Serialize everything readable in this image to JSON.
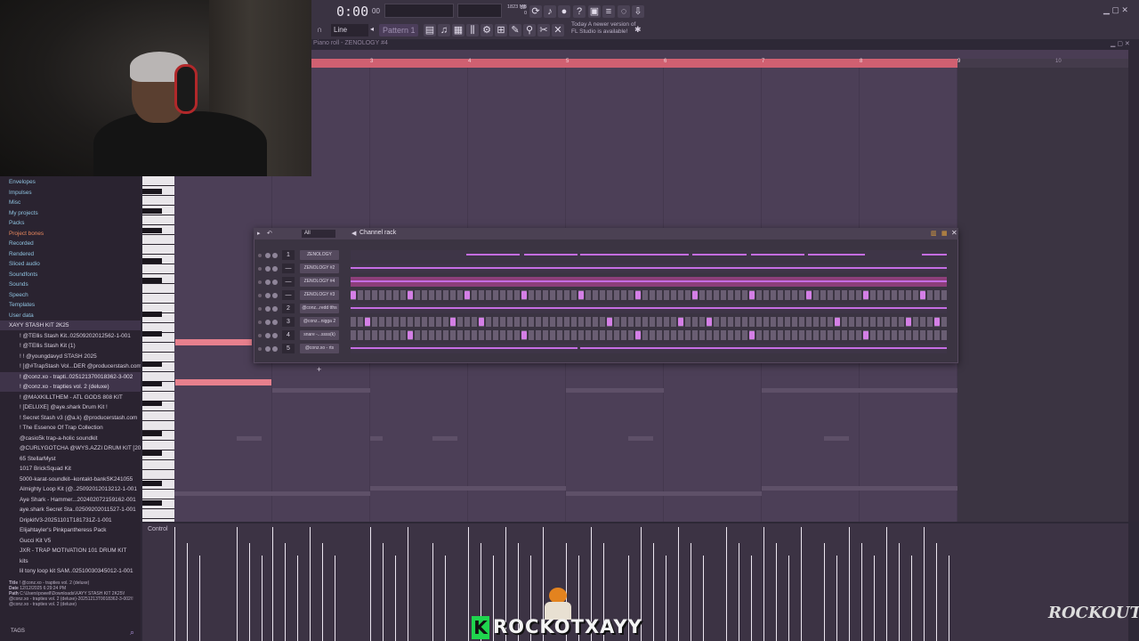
{
  "toolbar": {
    "time": "0:00",
    "time_sub": "00",
    "pattern": "Pattern 1",
    "snap": "Line",
    "cpu": "18",
    "mem": "1823 MB",
    "mem_sub": "0",
    "news_line1": "Today  A newer version of",
    "news_line2": "FL Studio is available!"
  },
  "piano_roll": {
    "title": "Piano roll - ZENOLOGY #4",
    "timeline_numbers": [
      "3",
      "4",
      "5",
      "6",
      "7",
      "8",
      "9",
      "10"
    ],
    "control_label": "Control"
  },
  "browser": {
    "items": [
      {
        "label": "Envelopes",
        "kind": "top"
      },
      {
        "label": "Impulses",
        "kind": "top"
      },
      {
        "label": "Misc",
        "kind": "top"
      },
      {
        "label": "My projects",
        "kind": "top"
      },
      {
        "label": "Packs",
        "kind": "top"
      },
      {
        "label": "Project bones",
        "kind": "proj"
      },
      {
        "label": "Recorded",
        "kind": "top"
      },
      {
        "label": "Rendered",
        "kind": "top"
      },
      {
        "label": "Sliced audio",
        "kind": "top"
      },
      {
        "label": "Soundfonts",
        "kind": "top"
      },
      {
        "label": "Sounds",
        "kind": "top"
      },
      {
        "label": "Speech",
        "kind": "top"
      },
      {
        "label": "Templates",
        "kind": "top"
      },
      {
        "label": "User data",
        "kind": "top"
      },
      {
        "label": "XAYY STASH KIT 2K25",
        "kind": "sel"
      },
      {
        "label": "! @TEllis Stash Kit..02509202012562-1-001",
        "kind": "sub"
      },
      {
        "label": "! @TEllis Stash Kit (1)",
        "kind": "sub"
      },
      {
        "label": "! ! @youngdavyd STASH 2025",
        "kind": "sub"
      },
      {
        "label": "! [@#TrapStash Vol...DER @producerstash.com",
        "kind": "sub"
      },
      {
        "label": "! @conz.xo - trapti..025121370018362-3-002",
        "kind": "sel"
      },
      {
        "label": "! @conz.xo - trapties vol. 2 (deluxe)",
        "kind": "sel"
      },
      {
        "label": "! @MAXKILLTHEM - ATL GODS 808 KIT",
        "kind": "sub"
      },
      {
        "label": "! [DELUXE] @aye.shark Drum Kit !",
        "kind": "sub"
      },
      {
        "label": "! Secret Stash v3 (@a.k) @producerstash.com",
        "kind": "sub"
      },
      {
        "label": "! The Essence Of Trap Collection",
        "kind": "sub"
      },
      {
        "label": "@casio5k trap-a-holic soundkit",
        "kind": "sub"
      },
      {
        "label": "@CURLYGOTCHA @WYS.AZZI DRUM KIT [200+]",
        "kind": "sub"
      },
      {
        "label": "65 StellarMyst",
        "kind": "sub"
      },
      {
        "label": "1017 BrickSquad Kit",
        "kind": "sub"
      },
      {
        "label": "5000-karat-soundkit--kontakt-bankSK241055",
        "kind": "sub"
      },
      {
        "label": "Almighty Loop Kit (@..25092012013212-1-001",
        "kind": "sub"
      },
      {
        "label": "Aye Shark - Hammer...202402072159162-001",
        "kind": "sub"
      },
      {
        "label": "aye.shark Secret Sta..02509202011527-1-001",
        "kind": "sub"
      },
      {
        "label": "DripkitV3-20251101T181731Z-1-001",
        "kind": "sub"
      },
      {
        "label": "Elijahtayler's Pinkpantheress Pack",
        "kind": "sub"
      },
      {
        "label": "Gucci Kit V5",
        "kind": "sub"
      },
      {
        "label": "JXR - TRAP MOTIVATION 101 DRUM KIT",
        "kind": "sub"
      },
      {
        "label": "kits",
        "kind": "sub"
      },
      {
        "label": "lil tony loop kit SAM..02510030345012-1-001",
        "kind": "sub"
      }
    ],
    "info_title_label": "Title",
    "info_title": "! @conz.xo - trapties vol. 2 (deluxe)",
    "info_date_label": "Date",
    "info_date": "12/12/2025 6:29:24 PM",
    "info_path_label": "Path",
    "info_path": "C:\\Users\\powell\\Downloads\\XAYY STASH KIT 2K25\\! @conz.xo - trapties vol. 2 (deluxe)-20251213T0018362-3-002\\! @conz.xo - trapties vol. 2 (deluxe)",
    "tags_label": "TAGS"
  },
  "channel_rack": {
    "title": "Channel rack",
    "filter": "All",
    "channels": [
      {
        "num": "1",
        "name": "ZENOLOGY"
      },
      {
        "num": "—",
        "name": "ZENOLOGY #2"
      },
      {
        "num": "—",
        "name": "ZENOLOGY #4"
      },
      {
        "num": "—",
        "name": "ZENOLOGY #3"
      },
      {
        "num": "2",
        "name": "@conz...redd tths"
      },
      {
        "num": "3",
        "name": "@conz...nigga 2"
      },
      {
        "num": "4",
        "name": "snare -...ssss(k)"
      },
      {
        "num": "5",
        "name": "@conz.xo - rts"
      }
    ]
  },
  "overlay": {
    "brand_k": "K",
    "brand": "ROCKOTXAYY",
    "logo": "ROCKOUT"
  },
  "colors": {
    "accent_pink": "#e7808d",
    "step_purple": "#d47fe6",
    "green": "#1fd54e"
  }
}
